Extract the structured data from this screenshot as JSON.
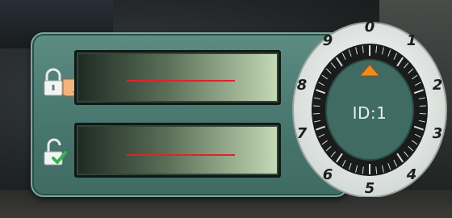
{
  "lock_panel": {
    "fields": [
      {
        "name": "entry-field-current",
        "value": ""
      },
      {
        "name": "entry-field-confirm",
        "value": ""
      }
    ],
    "icons": {
      "row1": "lock-icon, pointing-hand-icon",
      "row2": "unlock-check-icon"
    }
  },
  "dial": {
    "digits": [
      "0",
      "1",
      "2",
      "3",
      "4",
      "5",
      "6",
      "7",
      "8",
      "9"
    ],
    "id_label": "ID:1",
    "indicator_color": "#f08c1e"
  },
  "colors": {
    "panel": "#4a7a71",
    "redline": "#e0232a",
    "dial_ring": "#e8ece9",
    "dial_face": "#3f6b63"
  }
}
